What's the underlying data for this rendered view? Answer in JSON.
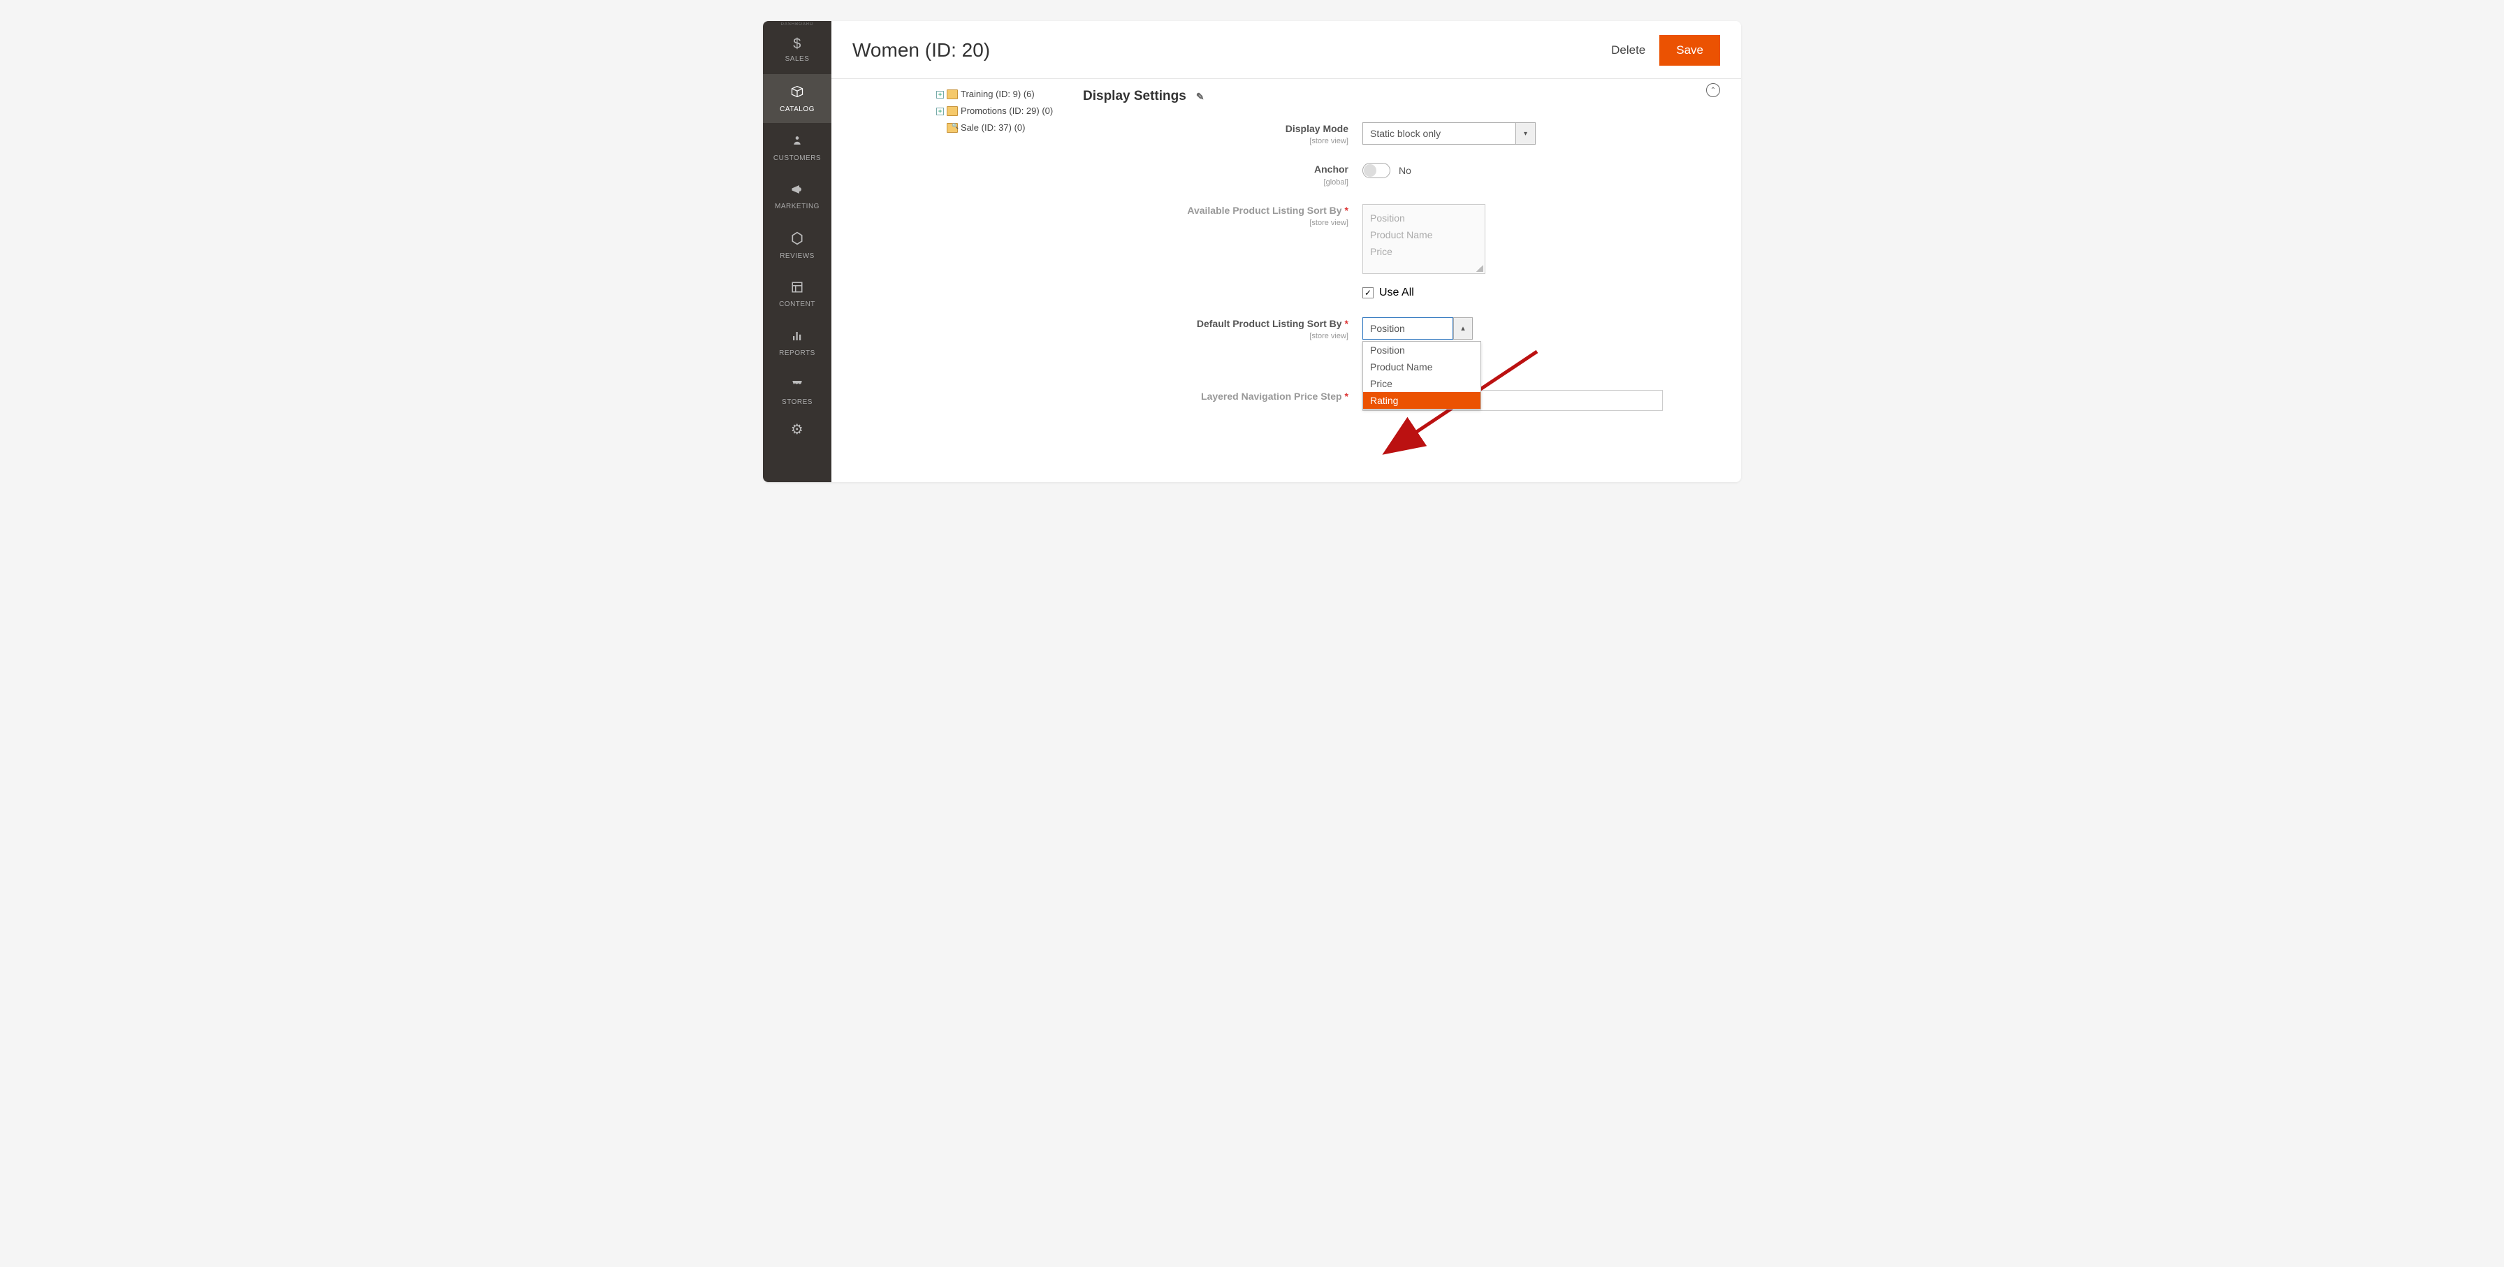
{
  "sidebar": {
    "items": [
      {
        "label": "DASHBOARD"
      },
      {
        "label": "SALES"
      },
      {
        "label": "CATALOG"
      },
      {
        "label": "CUSTOMERS"
      },
      {
        "label": "MARKETING"
      },
      {
        "label": "REVIEWS"
      },
      {
        "label": "CONTENT"
      },
      {
        "label": "REPORTS"
      },
      {
        "label": "STORES"
      },
      {
        "label": "SYSTEM"
      }
    ]
  },
  "header": {
    "title": "Women (ID: 20)",
    "delete": "Delete",
    "save": "Save"
  },
  "tree": {
    "items": [
      "Training (ID: 9) (6)",
      "Promotions (ID: 29) (0)",
      "Sale (ID: 37) (0)"
    ]
  },
  "section": {
    "title": "Display Settings"
  },
  "fields": {
    "display_mode": {
      "label": "Display Mode",
      "scope": "[store view]",
      "value": "Static block only"
    },
    "anchor": {
      "label": "Anchor",
      "scope": "[global]",
      "value": "No"
    },
    "avail_sort": {
      "label": "Available Product Listing Sort By",
      "scope": "[store view]",
      "options": [
        "Position",
        "Product Name",
        "Price"
      ]
    },
    "use_all": {
      "label": "Use All"
    },
    "default_sort": {
      "label": "Default Product Listing Sort By",
      "scope": "[store view]",
      "value": "Position",
      "options": [
        "Position",
        "Product Name",
        "Price",
        "Rating"
      ]
    },
    "price_step": {
      "label": "Layered Navigation Price Step"
    }
  }
}
